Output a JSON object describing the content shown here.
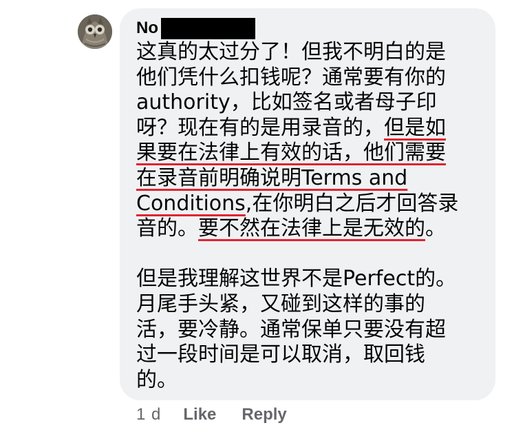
{
  "comment": {
    "author": {
      "name_visible": "No",
      "avatar_icon": "owl-avatar-icon"
    },
    "paragraphs": [
      {
        "lines": [
          [
            {
              "text": "这真的太过分了！但我不明白的是",
              "underline": false
            }
          ],
          [
            {
              "text": "他们凭什么扣钱呢？通常要有你的",
              "underline": false
            }
          ],
          [
            {
              "text": "authority，比如签名或者母子印",
              "underline": false
            }
          ],
          [
            {
              "text": "呀？现在有的是用录音的，",
              "underline": false
            },
            {
              "text": "但是如",
              "underline": true
            }
          ],
          [
            {
              "text": "果要在法律上有效的话，他们需要",
              "underline": true
            }
          ],
          [
            {
              "text": "在录音前明确说明Terms and",
              "underline": true
            }
          ],
          [
            {
              "text": "Conditions",
              "underline": true
            },
            {
              "text": ",在你明白之后才回答录",
              "underline": false
            }
          ],
          [
            {
              "text": "音的。",
              "underline": false
            },
            {
              "text": "要不然在法律上是无效的",
              "underline": true
            },
            {
              "text": "。",
              "underline": false
            }
          ]
        ]
      },
      {
        "lines": [
          [
            {
              "text": "但是我理解这世界不是Perfect的。",
              "underline": false
            }
          ],
          [
            {
              "text": "月尾手头紧，又碰到这样的事的",
              "underline": false
            }
          ],
          [
            {
              "text": "活，要冷静。通常保单只要没有超",
              "underline": false
            }
          ],
          [
            {
              "text": "过一段时间是可以取消，取回钱",
              "underline": false
            }
          ],
          [
            {
              "text": "的。",
              "underline": false
            }
          ]
        ]
      }
    ],
    "timestamp": "1 d",
    "actions": {
      "like_label": "Like",
      "reply_label": "Reply"
    },
    "colors": {
      "bubble_background": "#f0f1f3",
      "text": "#050505",
      "meta_text": "#65676b",
      "underline_mark": "#e0242f"
    }
  }
}
